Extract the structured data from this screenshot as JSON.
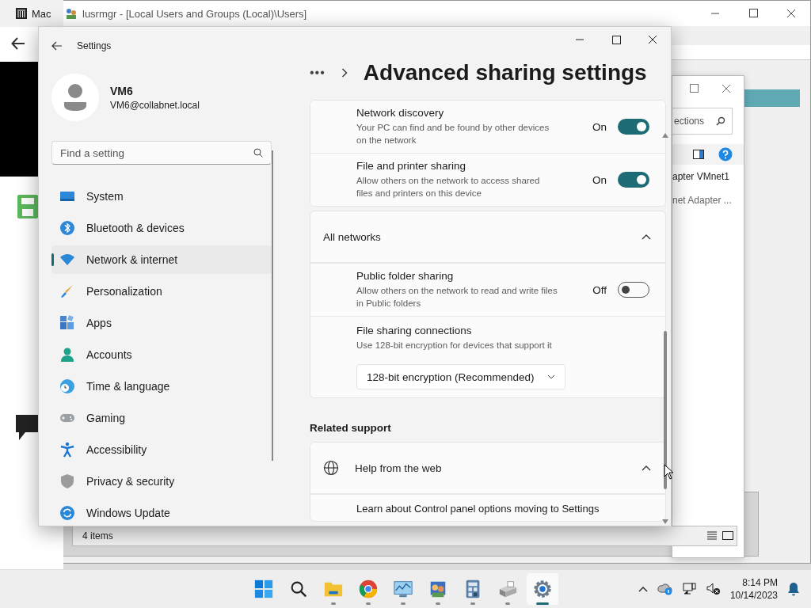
{
  "background_browser": {
    "tab_title": "Mac"
  },
  "lusrmgr_window": {
    "title": "lusrmgr - [Local Users and Groups (Local)\\Users]"
  },
  "network_connections_window": {
    "search_placeholder": "ections",
    "items": [
      "apter VMnet1",
      "net Adapter ..."
    ],
    "status": "4 items"
  },
  "settings": {
    "title": "Settings",
    "user": {
      "name": "VM6",
      "email": "VM6@collabnet.local"
    },
    "search": {
      "placeholder": "Find a setting"
    },
    "nav": [
      {
        "label": "System",
        "selected": false
      },
      {
        "label": "Bluetooth & devices",
        "selected": false
      },
      {
        "label": "Network & internet",
        "selected": true
      },
      {
        "label": "Personalization",
        "selected": false
      },
      {
        "label": "Apps",
        "selected": false
      },
      {
        "label": "Accounts",
        "selected": false
      },
      {
        "label": "Time & language",
        "selected": false
      },
      {
        "label": "Gaming",
        "selected": false
      },
      {
        "label": "Accessibility",
        "selected": false
      },
      {
        "label": "Privacy & security",
        "selected": false
      },
      {
        "label": "Windows Update",
        "selected": false
      }
    ],
    "breadcrumb_more": "•••",
    "page_title": "Advanced sharing settings",
    "private_card": {
      "rows": [
        {
          "kind": "toggle",
          "title": "Network discovery",
          "description": "Your PC can find and be found by other devices on the network",
          "state_label": "On",
          "on": true
        },
        {
          "kind": "toggle",
          "title": "File and printer sharing",
          "description": "Allow others on the network to access shared files and printers on this device",
          "state_label": "On",
          "on": true
        }
      ]
    },
    "all_networks": {
      "title": "All networks",
      "expanded": true,
      "rows": [
        {
          "kind": "toggle",
          "title": "Public folder sharing",
          "description": "Allow others on the network to read and write files in Public folders",
          "state_label": "Off",
          "on": false
        },
        {
          "kind": "dropdown",
          "title": "File sharing connections",
          "description": "Use 128-bit encryption for devices that support it",
          "value": "128-bit encryption (Recommended)"
        }
      ]
    },
    "related_support": {
      "heading": "Related support",
      "title": "Help from the web",
      "expanded": true,
      "links": [
        "Learn about Control panel options moving to Settings"
      ]
    }
  },
  "taskbar": {
    "apps": [
      {
        "kind": "start",
        "running": false,
        "active": false
      },
      {
        "kind": "search",
        "running": false,
        "active": false
      },
      {
        "kind": "explorer",
        "running": true,
        "active": false
      },
      {
        "kind": "browser",
        "running": true,
        "active": false
      },
      {
        "kind": "monitor",
        "running": true,
        "active": false
      },
      {
        "kind": "users",
        "running": true,
        "active": false
      },
      {
        "kind": "calculator",
        "running": true,
        "active": false
      },
      {
        "kind": "printer",
        "running": true,
        "active": false
      },
      {
        "kind": "settings",
        "running": true,
        "active": true
      }
    ],
    "time": "8:14 PM",
    "date": "10/14/2023"
  }
}
